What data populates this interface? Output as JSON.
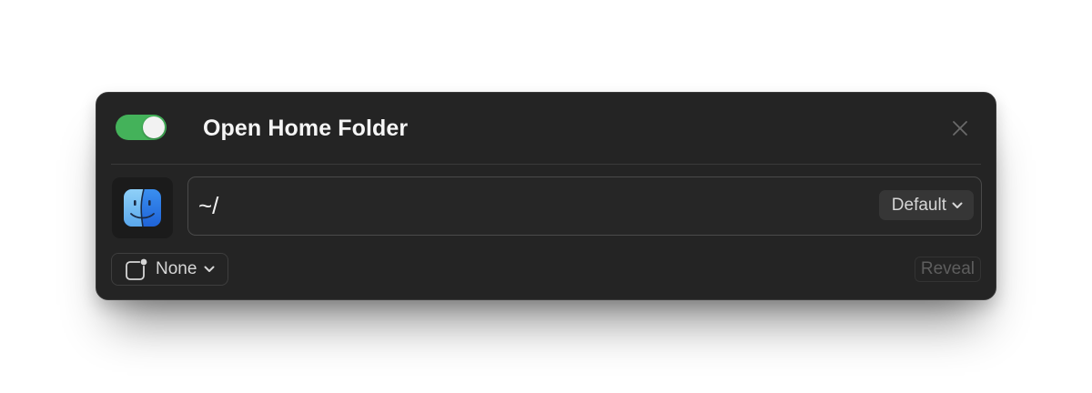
{
  "command": {
    "title": "Open Home Folder",
    "enabled": true
  },
  "path_field": {
    "value": "~/",
    "open_with_label": "Default"
  },
  "hotkey": {
    "label": "None"
  },
  "actions": {
    "reveal_label": "Reveal"
  },
  "icons": {
    "toggle": "toggle-switch",
    "close": "close-icon",
    "app": "finder-icon",
    "hotkey": "hotkey-icon",
    "chevron": "chevron-down-icon"
  },
  "colors": {
    "panel_bg": "#242424",
    "toggle_on": "#44b25a",
    "text_primary": "#f5f5f5",
    "text_secondary": "#d6d6d6",
    "text_disabled": "#5e5e5e"
  }
}
